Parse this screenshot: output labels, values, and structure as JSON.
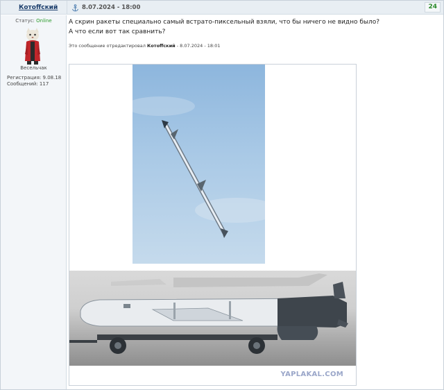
{
  "post": {
    "author": "Котоffский",
    "date": "8.07.2024 - 18:00",
    "number": "24"
  },
  "user": {
    "status_label": "Статус:",
    "status_value": "Online",
    "rank": "Весельчак",
    "registration": "Регистрация: 9.08.18",
    "posts_count": "Сообщений: 117"
  },
  "message": {
    "line1": "А скрин ракеты специально самый встрато-пиксельный взяли, что бы ничего не видно было?",
    "line2": "А что если вот так сравнить?",
    "edited_prefix": "Это сообщение отредактировал",
    "edited_by": "Котоffский",
    "edited_date": "- 8.07.2024 - 18:01"
  },
  "image": {
    "watermark": "YAPLAKAL.COM"
  },
  "colors": {
    "accent": "#1a3d6b",
    "online": "#2a9a2a",
    "post_number": "#2a8a2a"
  },
  "icons": {
    "anchor": "anchor-icon"
  }
}
